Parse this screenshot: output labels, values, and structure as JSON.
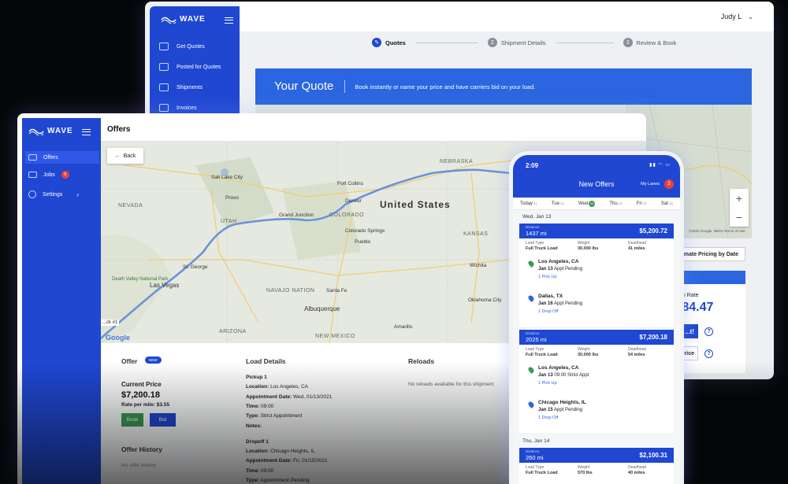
{
  "brand": {
    "name": "WAVE"
  },
  "back_window": {
    "user": "Judy L",
    "nav": [
      {
        "label": "Get Quotes"
      },
      {
        "label": "Posted for Quotes"
      },
      {
        "label": "Shipments"
      },
      {
        "label": "Invoices"
      }
    ],
    "steps": [
      {
        "num": "",
        "label": "Quotes",
        "active": true
      },
      {
        "num": "2",
        "label": "Shipment Details"
      },
      {
        "num": "3",
        "label": "Review & Book"
      }
    ],
    "banner_title": "Your Quote",
    "banner_sub": "Book instantly or name your price and have carriers bid on your load.",
    "map_attr": "©2020 Google, INEGI  Terms of Use",
    "estimate_button": "...mate Pricing by Date",
    "rate_label": "...n Rate",
    "rate_value": "...84.47",
    "rate_button": "...t!",
    "rate_button2": "...r Price"
  },
  "front_window": {
    "title": "Offers",
    "nav": [
      {
        "label": "Offers"
      },
      {
        "label": "Jobs",
        "badge": "6"
      },
      {
        "label": "Settings"
      }
    ],
    "back_label": "Back",
    "map_labels": {
      "country": "United States",
      "states": [
        "NEVADA",
        "UTAH",
        "COLORADO",
        "KANSAS",
        "NEBRASKA",
        "ARIZONA",
        "NEW MEXICO",
        "NAVAJO NATION"
      ],
      "cities": [
        "Salt Lake City",
        "Provo",
        "Fort Collins",
        "Denver",
        "Colorado Springs",
        "Pueblo",
        "Grand Junction",
        "St. George",
        "Las Vegas",
        "Albuquerque",
        "Santa Fe",
        "Oklahoma City",
        "Wichita",
        "Amarillo"
      ],
      "parks": [
        "Death Valley National Park"
      ]
    },
    "track_tag": "...ck #1",
    "offer": {
      "heading": "Offer",
      "new_tag": "NEW",
      "current_price_label": "Current Price",
      "current_price": "$7,200.18",
      "rate_per_mile": "Rate per mile: $3.55",
      "book_label": "Book",
      "bid_label": "Bid",
      "history_heading": "Offer History",
      "history_empty": "No offer history"
    },
    "load_details": {
      "heading": "Load Details",
      "lines": [
        {
          "label": "Pickup 1",
          "value": ""
        },
        {
          "label": "Location:",
          "value": "Los Angeles, CA"
        },
        {
          "label": "Appointment Date:",
          "value": "Wed, 01/13/2021"
        },
        {
          "label": "Time:",
          "value": "09:00"
        },
        {
          "label": "Type:",
          "value": "Strict Appointment"
        },
        {
          "label": "Notes:",
          "value": ""
        },
        {
          "label": "Dropoff 1",
          "value": ""
        },
        {
          "label": "Location:",
          "value": "Chicago Heights, IL"
        },
        {
          "label": "Appointment Date:",
          "value": "Fri, 01/15/2021"
        },
        {
          "label": "Time:",
          "value": "09:00"
        },
        {
          "label": "Type:",
          "value": "Appointment Pending"
        }
      ]
    },
    "reloads": {
      "heading": "Reloads",
      "empty": "No reloads available for this shipment"
    }
  },
  "phone": {
    "time": "2:09",
    "status_icons": "▮▮ ◠ ▭",
    "title": "New Offers",
    "lanes_label": "My Lanes",
    "lanes_badge": "2",
    "days": [
      {
        "name": "Today",
        "num": "11"
      },
      {
        "name": "Tue",
        "num": "12"
      },
      {
        "name": "Wed",
        "num": "13",
        "today": true
      },
      {
        "name": "Thu",
        "num": "14"
      },
      {
        "name": "Fri",
        "num": "15"
      },
      {
        "name": "Sat",
        "num": "16"
      }
    ],
    "date1": "Wed, Jan 13",
    "date2": "Thu, Jan 14",
    "meta_labels": {
      "type": "Load Type",
      "weight": "Weight",
      "deadhead": "Deadhead"
    },
    "cards": [
      {
        "distance_label": "Distance",
        "distance": "1437 mi",
        "rate": "$5,200.72",
        "load_type": "Full Truck Load",
        "weight": "30,000 lbs",
        "deadhead": "41 miles",
        "stops": [
          {
            "city": "Los Angeles, CA",
            "date": "Jan 13",
            "appt": "Appt Pending",
            "link": "1 Pick Up",
            "kind": "pickup"
          },
          {
            "city": "Dallas, TX",
            "date": "Jan 16",
            "appt": "Appt Pending",
            "link": "1 Drop Off",
            "kind": "dropoff"
          }
        ]
      },
      {
        "distance_label": "Distance",
        "distance": "2025 mi",
        "rate": "$7,200.18",
        "load_type": "Full Truck Load",
        "weight": "30,000 lbs",
        "deadhead": "54 miles",
        "stops": [
          {
            "city": "Los Angeles, CA",
            "date": "Jan 13",
            "appt": "09:00 Strict Appt",
            "link": "1 Pick Up",
            "kind": "pickup"
          },
          {
            "city": "Chicago Heights, IL",
            "date": "Jan 15",
            "appt": "Appt Pending",
            "link": "1 Drop Off",
            "kind": "dropoff"
          }
        ]
      },
      {
        "distance_label": "Distance",
        "distance": "260 mi",
        "rate": "$2,100.31",
        "load_type": "Full Truck Load",
        "weight": "570 lbs",
        "deadhead": "40 miles"
      }
    ]
  },
  "colors": {
    "brand_blue": "#1f47d2",
    "banner_blue": "#2b66e0",
    "book_green": "#3a9a52",
    "badge_red": "#e8433a"
  }
}
